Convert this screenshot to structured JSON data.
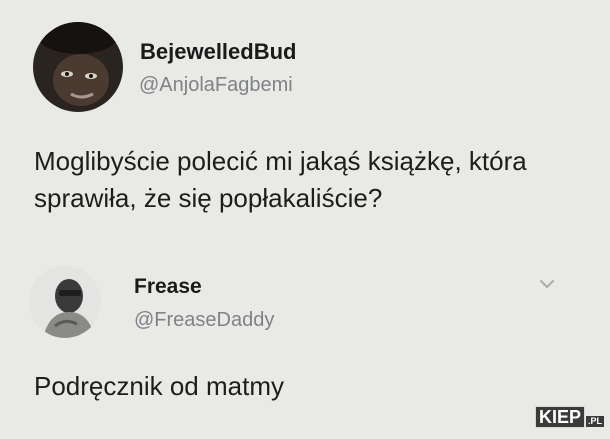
{
  "tweet": {
    "author": {
      "display_name": "BejewelledBud",
      "handle": "@AnjolaFagbemi",
      "avatar_icon": "avatar-photo"
    },
    "text_lines": [
      "Moglibyście polecić mi jakąś książkę, która",
      "sprawiła, że się popłakaliście?"
    ]
  },
  "reply": {
    "author": {
      "display_name": "Frease",
      "handle": "@FreaseDaddy",
      "avatar_icon": "avatar-photo"
    },
    "text_lines": [
      "Podręcznik od matmy"
    ],
    "menu_icon": "chevron-down-icon"
  },
  "watermark": {
    "text": "KIEP",
    "suffix": ".PL"
  },
  "colors": {
    "background": "#e9eae5",
    "text": "#1d1d1d",
    "handle": "#7f8288"
  }
}
